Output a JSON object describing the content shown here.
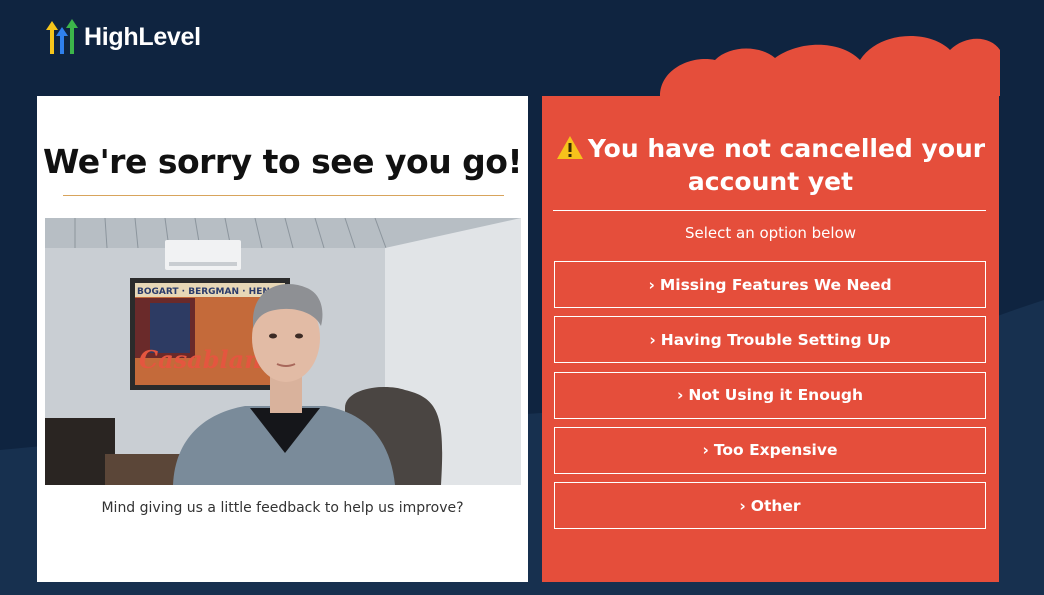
{
  "brand": {
    "name": "HighLevel",
    "colors": {
      "yellow": "#f6c51b",
      "green": "#3cb54a",
      "blue": "#2f80ed"
    }
  },
  "left": {
    "title": "We're sorry to see you go!",
    "feedback": "Mind giving us a little feedback to help us improve?",
    "video": {
      "poster_top": "BOGART · BERGMAN · HEN",
      "poster_script": "Casablanca"
    }
  },
  "right": {
    "title": "You have not cancelled your account yet",
    "subtitle": "Select an option below",
    "options": [
      {
        "label": "Missing Features We Need"
      },
      {
        "label": "Having Trouble Setting Up"
      },
      {
        "label": "Not Using it Enough"
      },
      {
        "label": "Too Expensive"
      },
      {
        "label": "Other"
      }
    ]
  },
  "icons": {
    "warning": "warning-triangle-icon",
    "chevron": "chevron-right-icon"
  },
  "colors": {
    "background": "#0f2440",
    "panel_red": "#e54e3b",
    "divider_gold": "#d8a45c"
  }
}
